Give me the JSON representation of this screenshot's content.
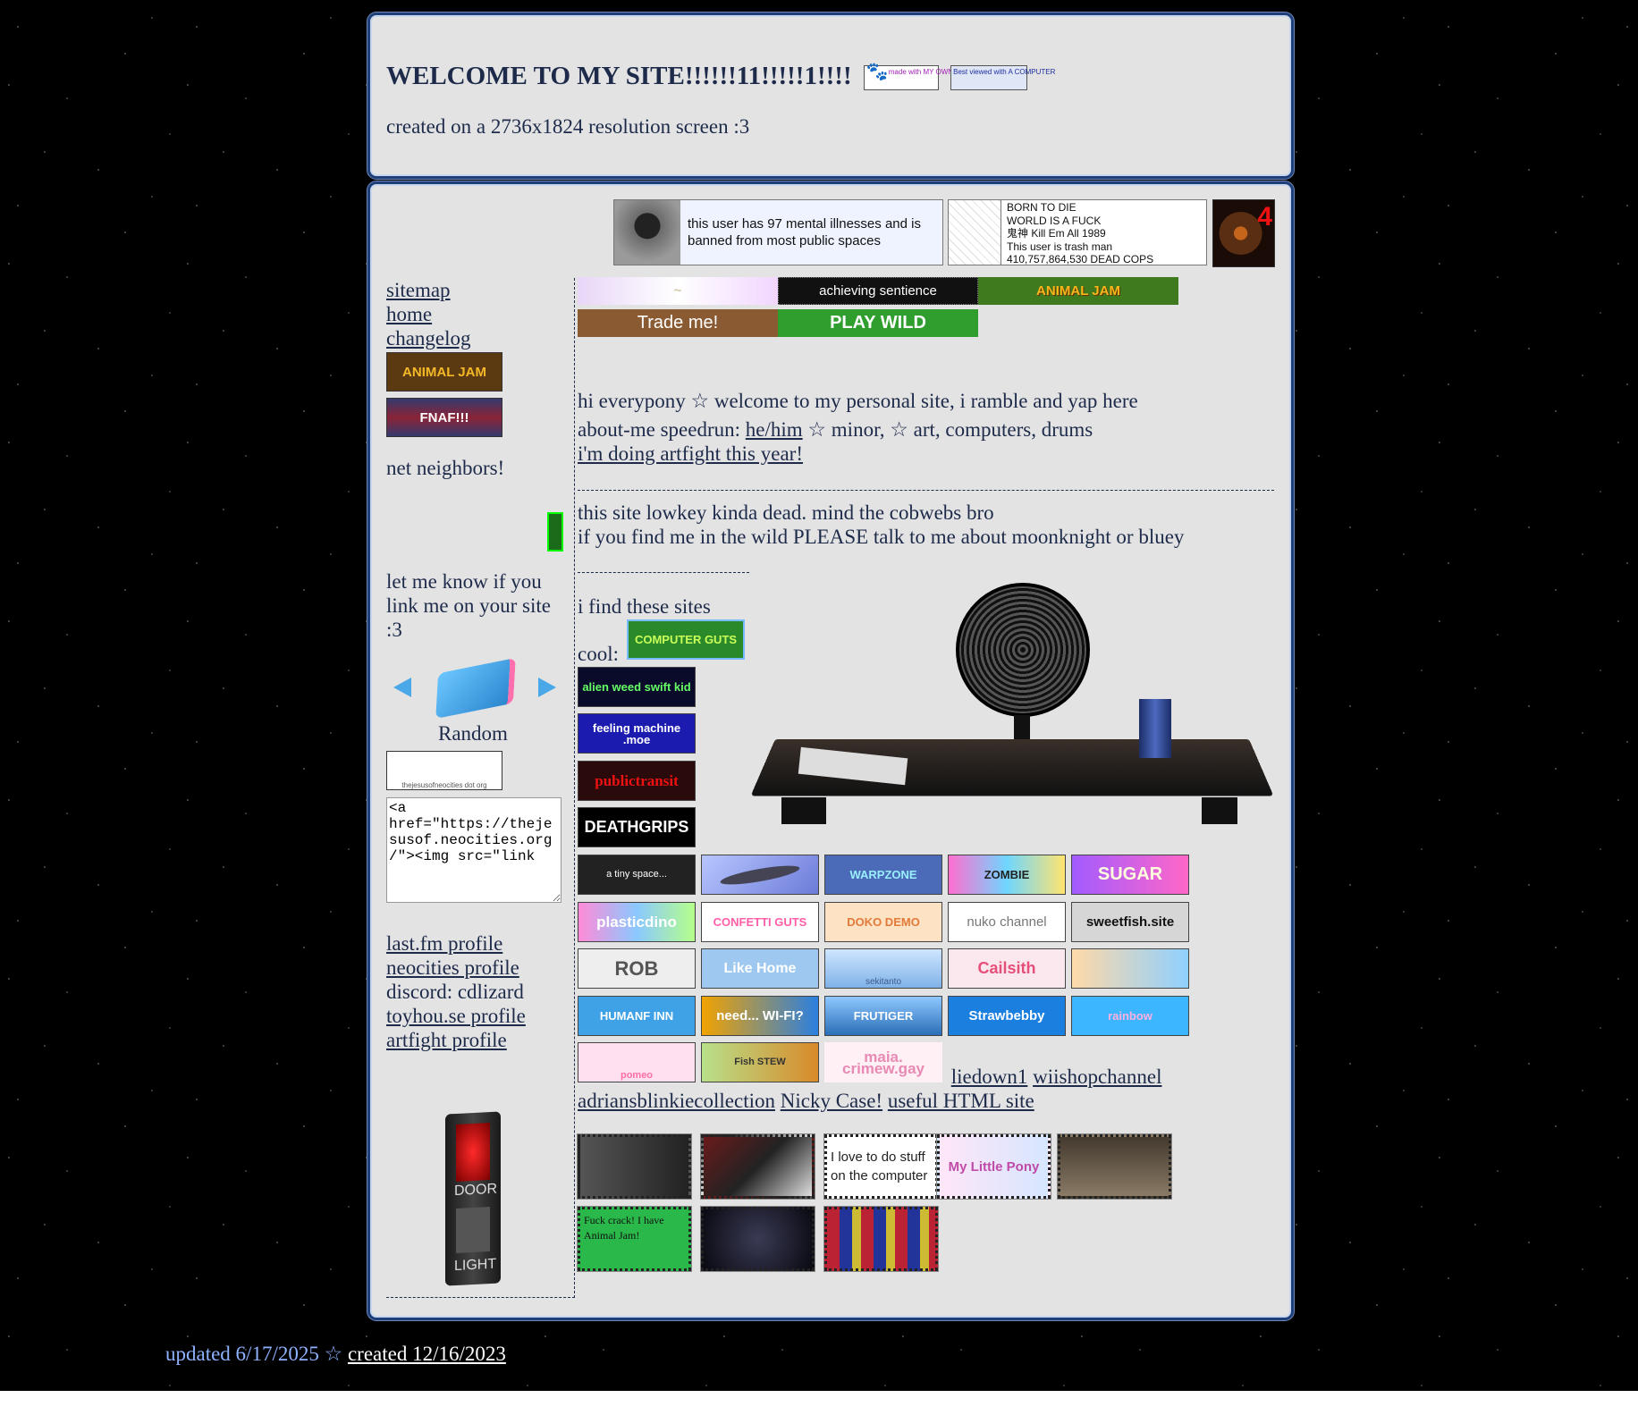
{
  "header": {
    "title": "WELCOME TO MY SITE!!!!!!11!!!!!1!!!!",
    "badge1": "made with MY OWN TWO PAWS",
    "badge2": "Best viewed with A COMPUTER",
    "subtitle": "created on a 2736x1824 resolution screen :3"
  },
  "userboxes": {
    "box1": "this user has 97 mental illnesses and is banned from most public spaces",
    "box2_lines": [
      "BORN TO DIE",
      "WORLD IS A FUCK",
      "鬼神 Kill Em All 1989",
      "This user is trash man",
      "410,757,864,530 DEAD COPS"
    ]
  },
  "banners": {
    "achieving": "achieving sentience",
    "animaljam": "ANIMAL JAM",
    "trade": "Trade me!",
    "playwild": "PLAY WILD"
  },
  "sidebar": {
    "nav": [
      "sitemap",
      "home",
      "changelog"
    ],
    "button_animaljam": "ANIMAL JAM",
    "button_fnaf": "FNAF!!!",
    "neighbors_heading": "net neighbors!",
    "link_me_text": "let me know if you link me on your site :3",
    "random_label": "Random",
    "my_button_caption": "thejesusofneocities dot org",
    "embed_code": "<a href=\"https://thejesusof.neocities.org/\"><img src=\"link",
    "profiles": {
      "lastfm": "last.fm profile",
      "neocities": "neocities profile",
      "discord": "discord: cdlizard",
      "toyhouse": "toyhou.se profile",
      "artfight": "artfight profile"
    },
    "door_top": "DOOR",
    "door_bottom": "LIGHT"
  },
  "content": {
    "intro": "hi everypony ☆ welcome to my personal site, i ramble and yap here",
    "about_prefix": "about-me speedrun:",
    "about_link": "he/him",
    "about_suffix": "☆ minor, ☆ art, computers, drums",
    "artfight_link": "i'm doing artfight this year!",
    "dead_line": "this site lowkey kinda dead. mind the cobwebs bro",
    "talk_line": "if you find me in the wild PLEASE talk to me about moonknight or bluey",
    "sites_heading_1": "i find these sites",
    "sites_heading_2": "cool:",
    "buttons": {
      "computer_guts": "COMPUTER GUTS",
      "alien_weed": "alien weed swift kid",
      "feeling_machine": "feeling machine .moe",
      "publictransit": "publictransit",
      "deathgrips": "DEATHGRIPS",
      "tiny_space": "a tiny space...",
      "warpzone": "WARPZONE",
      "zombie": "ZOMBIE",
      "sugar": "SUGAR",
      "plasticdino": "plasticdino",
      "confetti": "CONFETTI GUTS",
      "dokodemo": "DOKO DEMO",
      "nuko": "nuko channel",
      "sweetfish": "sweetfish.site",
      "rob": "ROB",
      "likehome": "Like Home",
      "sekitanto": "sekitanto",
      "cailsith": "Cailsith",
      "humanfinn": "HUMANF INN",
      "wifi": "need... WI-FI?",
      "frutiger": "FRUTIGER",
      "strawbebby": "Strawbebby",
      "rainbow": "rainbow",
      "pomeo": "pomeo",
      "fishstew": "Fish STEW",
      "maia": "maia. crimew.gay"
    },
    "text_links": [
      "liedown1",
      "wiishopchannel",
      "adriansblinkiecollection",
      "Nicky Case!",
      "useful HTML site"
    ],
    "stamps": {
      "computer": "I love to do stuff on the computer",
      "mlp": "My Little Pony",
      "animaljam": "Fuck crack! I have Animal Jam!"
    }
  },
  "footer": {
    "updated": "updated 6/17/2025 ☆",
    "created": "created 12/16/2023"
  }
}
